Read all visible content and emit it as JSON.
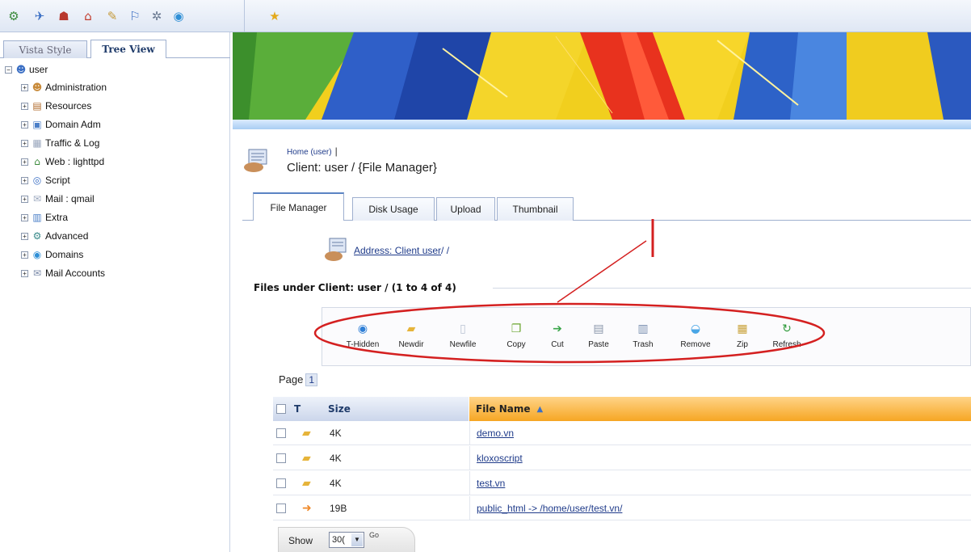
{
  "toolbar": {
    "icons": [
      "settings-icon",
      "bird-icon",
      "user-icon",
      "home-icon",
      "tools-icon",
      "help-icon",
      "gears-icon",
      "globe-icon",
      "star-icon"
    ]
  },
  "left_tabs": {
    "vista": "Vista Style",
    "tree": "Tree View"
  },
  "tree": {
    "root": "user",
    "items": [
      {
        "label": "Administration",
        "icon": "people-icon"
      },
      {
        "label": "Resources",
        "icon": "resources-icon"
      },
      {
        "label": "Domain Adm",
        "icon": "domain-icon"
      },
      {
        "label": "Traffic & Log",
        "icon": "log-icon"
      },
      {
        "label": "Web : lighttpd",
        "icon": "web-icon"
      },
      {
        "label": "Script",
        "icon": "script-icon"
      },
      {
        "label": "Mail : qmail",
        "icon": "mail-icon"
      },
      {
        "label": "Extra",
        "icon": "extra-icon"
      },
      {
        "label": "Advanced",
        "icon": "advanced-icon"
      },
      {
        "label": "Domains",
        "icon": "domains-icon"
      },
      {
        "label": "Mail Accounts",
        "icon": "mail-accounts-icon"
      }
    ]
  },
  "header": {
    "breadcrumb": "Home (user)",
    "breadcrumb_sep": "|",
    "title": "Client: user / {File Manager}"
  },
  "tabs": [
    "File Manager",
    "Disk Usage",
    "Upload",
    "Thumbnail"
  ],
  "address": {
    "link": "Address: Client user",
    "suffix": "/ /"
  },
  "files_title": "Files under Client: user / (1 to 4 of 4)",
  "actions": [
    {
      "label": "T-Hidden",
      "icon": "hidden-icon"
    },
    {
      "label": "Newdir",
      "icon": "new-folder-icon"
    },
    {
      "label": "Newfile",
      "icon": "new-file-icon"
    },
    {
      "label": "Copy",
      "icon": "copy-icon"
    },
    {
      "label": "Cut",
      "icon": "cut-icon"
    },
    {
      "label": "Paste",
      "icon": "paste-icon"
    },
    {
      "label": "Trash",
      "icon": "trash-icon"
    },
    {
      "label": "Remove",
      "icon": "remove-icon"
    },
    {
      "label": "Zip",
      "icon": "zip-icon"
    },
    {
      "label": "Refresh",
      "icon": "refresh-icon"
    }
  ],
  "pagination": {
    "label": "Page",
    "current": "1"
  },
  "grid": {
    "col_type": "T",
    "col_size": "Size",
    "col_name": "File Name",
    "sort_indicator": "▲",
    "rows": [
      {
        "type_icon": "folder-icon",
        "size": "4K",
        "name": "demo.vn"
      },
      {
        "type_icon": "folder-icon",
        "size": "4K",
        "name": "kloxoscript"
      },
      {
        "type_icon": "folder-icon",
        "size": "4K",
        "name": "test.vn"
      },
      {
        "type_icon": "symlink-icon",
        "size": "19B",
        "name": "public_html -> /home/user/test.vn/"
      }
    ]
  },
  "show": {
    "label": "Show",
    "value": "30(",
    "go": "Go"
  },
  "colors": {
    "accent": "#5b84c4",
    "link": "#1f3b8a",
    "header_orange": "#f6a623",
    "annotation_red": "#d42020"
  }
}
